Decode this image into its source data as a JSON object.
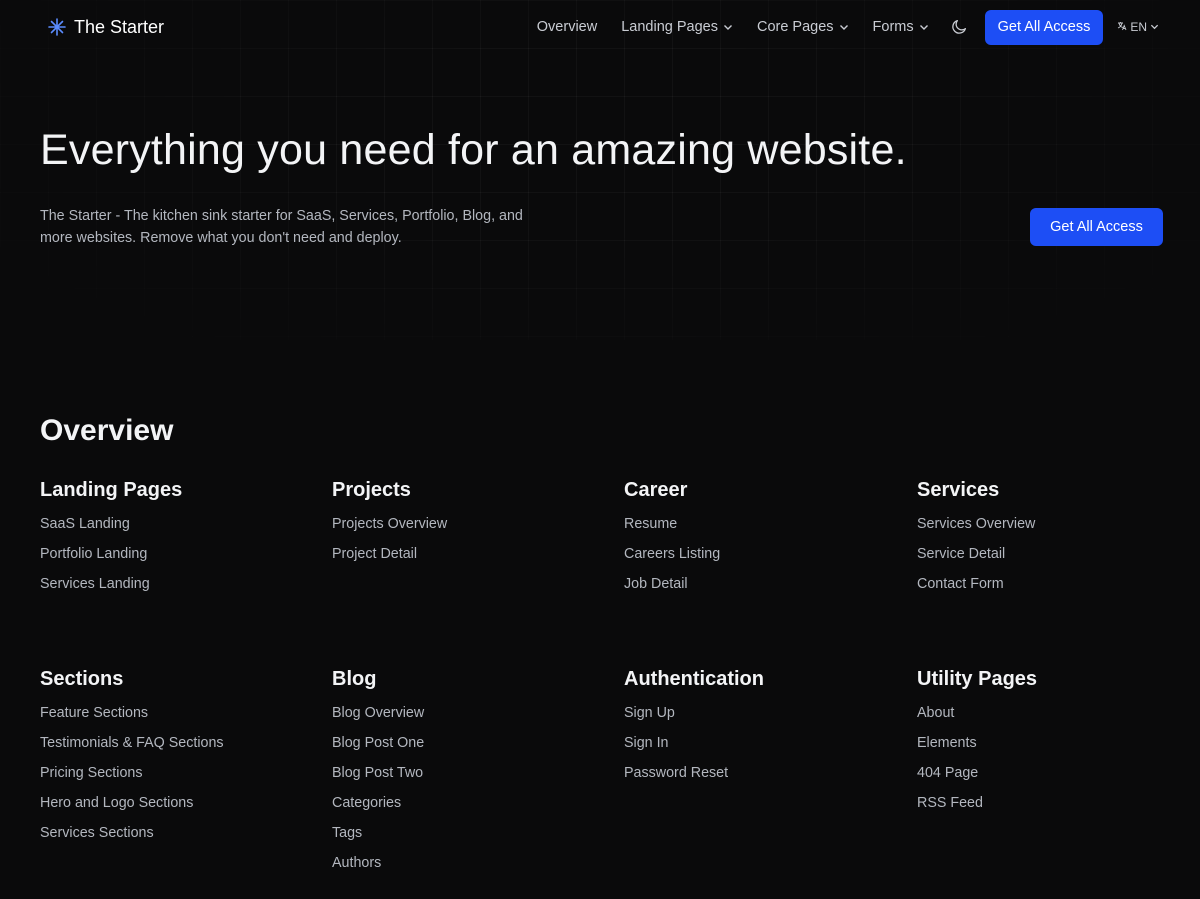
{
  "brand": {
    "name": "The Starter"
  },
  "nav": {
    "links": [
      {
        "label": "Overview",
        "dropdown": false
      },
      {
        "label": "Landing Pages",
        "dropdown": true
      },
      {
        "label": "Core Pages",
        "dropdown": true
      },
      {
        "label": "Forms",
        "dropdown": true
      }
    ],
    "cta_label": "Get All Access",
    "lang_label": "EN",
    "theme_icon": "moon-icon"
  },
  "hero": {
    "title": "Everything you need for an amazing website.",
    "description": "The Starter - The kitchen sink starter for SaaS, Services, Portfolio, Blog, and more websites. Remove what you don't need and deploy.",
    "cta_label": "Get All Access"
  },
  "overview": {
    "title": "Overview",
    "columns": [
      {
        "title": "Landing Pages",
        "links": [
          "SaaS Landing",
          "Portfolio Landing",
          "Services Landing"
        ]
      },
      {
        "title": "Projects",
        "links": [
          "Projects Overview",
          "Project Detail"
        ]
      },
      {
        "title": "Career",
        "links": [
          "Resume",
          "Careers Listing",
          "Job Detail"
        ]
      },
      {
        "title": "Services",
        "links": [
          "Services Overview",
          "Service Detail",
          "Contact Form"
        ]
      },
      {
        "title": "Sections",
        "links": [
          "Feature Sections",
          "Testimonials & FAQ Sections",
          "Pricing Sections",
          "Hero and Logo Sections",
          "Services Sections"
        ]
      },
      {
        "title": "Blog",
        "links": [
          "Blog Overview",
          "Blog Post One",
          "Blog Post Two",
          "Categories",
          "Tags",
          "Authors"
        ]
      },
      {
        "title": "Authentication",
        "links": [
          "Sign Up",
          "Sign In",
          "Password Reset"
        ]
      },
      {
        "title": "Utility Pages",
        "links": [
          "About",
          "Elements",
          "404 Page",
          "RSS Feed"
        ]
      }
    ]
  },
  "colors": {
    "accent": "#1d4ef5",
    "background": "#0a0a0b",
    "brand_icon": "#5b8cff"
  }
}
